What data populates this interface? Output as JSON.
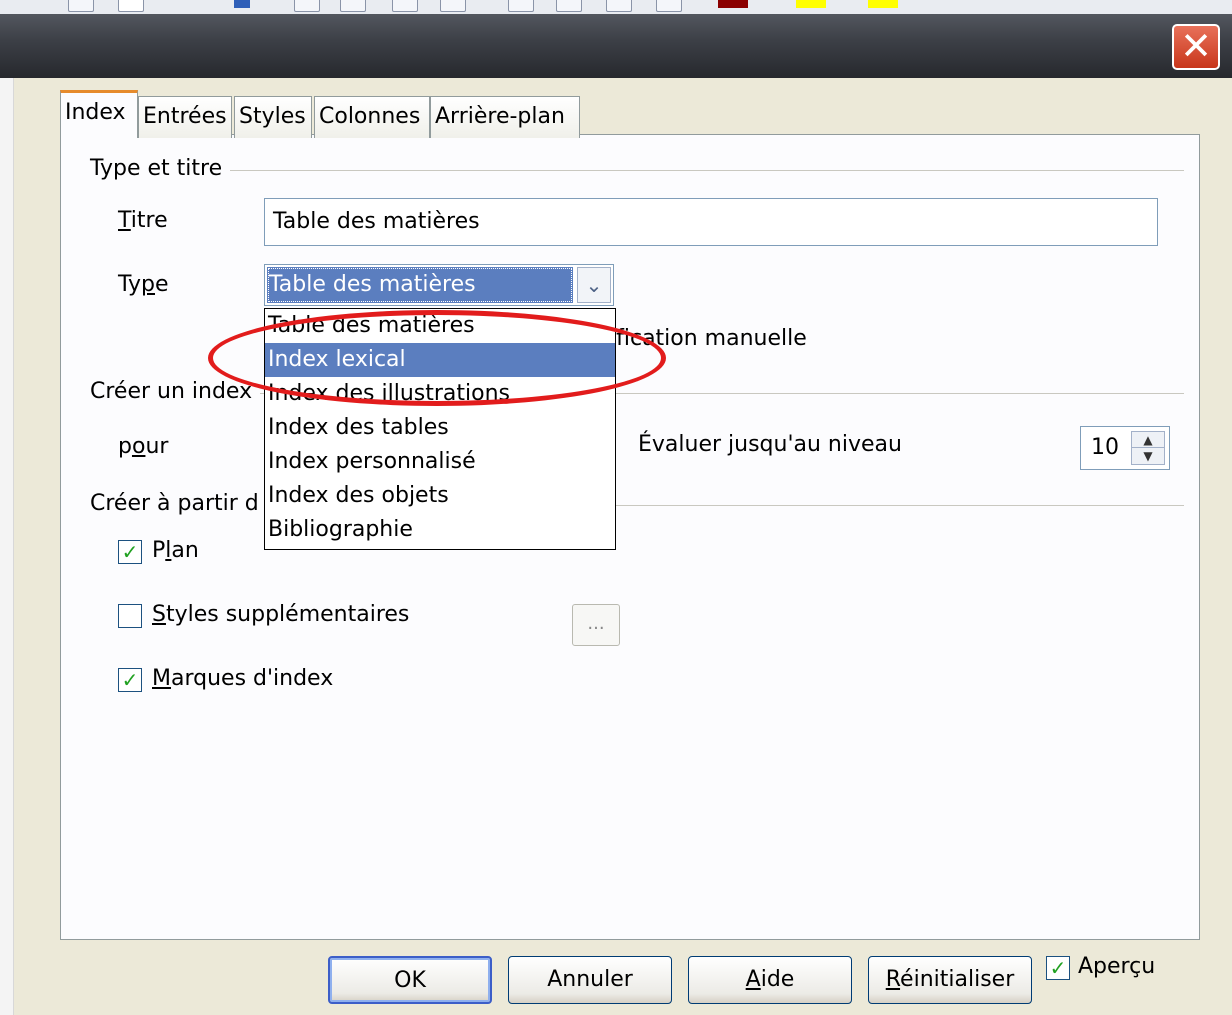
{
  "window": {
    "close_glyph": "✕",
    "close_icon": "close-icon"
  },
  "tabs": [
    {
      "label": "Index",
      "active": true
    },
    {
      "label": "Entrées",
      "active": false
    },
    {
      "label": "Styles",
      "active": false
    },
    {
      "label": "Colonnes",
      "active": false
    },
    {
      "label": "Arrière-plan",
      "active": false
    }
  ],
  "type_title_group": {
    "heading": "Type et titre",
    "title_label": "Titre",
    "title_value": "Table des matières",
    "type_label": "Type",
    "type_selected": "Table des matières",
    "manual_edit_text": "ification manuelle"
  },
  "type_dropdown": {
    "options": [
      "Table des matières",
      "Index lexical",
      "Index des illustrations",
      "Index des tables",
      "Index personnalisé",
      "Index des objets",
      "Bibliographie"
    ],
    "highlighted_index": 1
  },
  "create_index_group": {
    "heading": "Créer un index",
    "for_label": "pour",
    "evaluate_label": "Évaluer jusqu'au niveau",
    "level_value": "10"
  },
  "create_from_group": {
    "heading": "Créer à partir d",
    "plan_label": "Plan",
    "plan_checked": true,
    "extra_styles_label": "Styles supplémentaires",
    "extra_styles_checked": false,
    "extra_styles_button": "...",
    "index_marks_label": "Marques d'index",
    "index_marks_checked": true
  },
  "buttons": {
    "ok": "OK",
    "cancel": "Annuler",
    "help": "Aide",
    "reset": "Réinitialiser",
    "preview_label": "Aperçu",
    "preview_checked": true
  },
  "colors": {
    "selection": "#5b7ebf",
    "annotation_ellipse": "#e21c1c",
    "check_mark": "#21a121",
    "close_button": "#c8361b"
  }
}
